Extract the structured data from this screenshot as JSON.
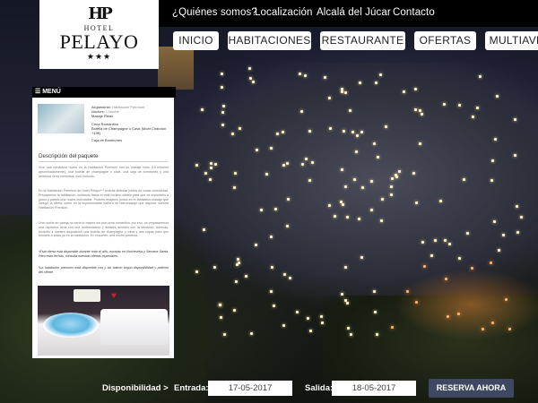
{
  "logo": {
    "monogram": "HP",
    "hotel_word": "HOTEL",
    "name": "PELAYO",
    "stars": "★★★"
  },
  "top_nav": {
    "items": [
      "¿Quiénes somos?",
      "Localización",
      "Alcalá del Júcar",
      "Contacto"
    ]
  },
  "main_nav": {
    "items": [
      "INICIO",
      "HABITACIONES",
      "RESTAURANTE",
      "OFERTAS",
      "MULTIAVE"
    ]
  },
  "menu": {
    "label": "☰ MENÚ"
  },
  "package": {
    "alojamiento_label": "Alojamiento:",
    "alojamiento_value": "Habitación Premium",
    "noches_label": "Noches:",
    "noches_value": "1 Noche",
    "items": [
      "Masaje Relax",
      "Cena Romántica",
      "Botella de Champagne o Cava (Moet Chandon +15€)",
      "Caja de Bombones"
    ]
  },
  "description": {
    "title": "Descripción del paquete",
    "p1": "Vive una romántica noche en la Habitación Premium con un masaje relax (15 minutos aproximadamente), una botella de champagne o cava, una caja de bombones y una deliciosa cena romántica, todo incluido.",
    "p2": "En la Habitación Premium de Hotel Pelayo*** podrás disfrutar juntos de todas comodidad. Prepararnos la habitación, cuidando hasta el más mínimo detalle para que os encontréis a gusto y paséis una noche inolvidable. Podréis relajaros juntos en el fantástico masaje que incluye la oferta, como en la impresionante bañera de hidromasaje que dispone nuestra Habitación Premium.",
    "p3": "Una noche en pareja no sería lo mismo sin una cena romántica, por eso, os prepararemos una riquísima cena con una ambientación y detalles acordes con la situación. Además, tendréis a vuestra disposición una botella de champagne o cava y dos copas para que brindéis a solas ya en la habitación. En resumen, una noche perfecta.",
    "note1": "*Esta oferta está disponible durante todo el año, excepto en Nochevieja y Semana Santa. Para esas fechas, consulta nuestras ofertas especiales.",
    "note2": "*La habitación premium está disponible con y sin balcón según disponibilidad y petición del cliente"
  },
  "booking": {
    "availability_label": "Disponibilidad >",
    "entry_label": "Entrada:",
    "entry_value": "17-05-2017",
    "exit_label": "Salida:",
    "exit_value": "18-05-2017",
    "reserve_label": "RESERVA AHORA"
  }
}
